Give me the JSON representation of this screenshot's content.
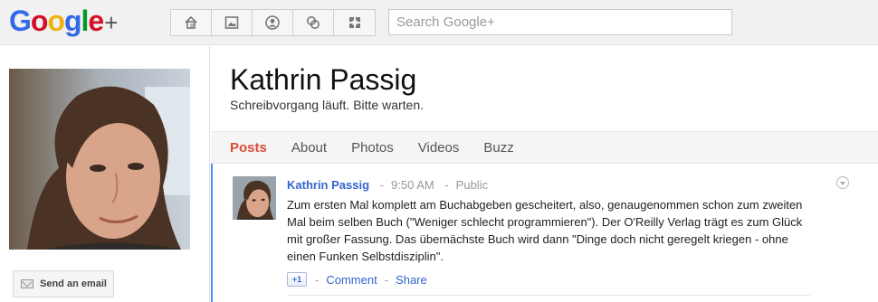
{
  "brand": {
    "logo_letters": [
      "G",
      "o",
      "o",
      "g",
      "l",
      "e"
    ],
    "logo_plus": "+",
    "colors": {
      "blue": "#3369e8",
      "red": "#d50f25",
      "yellow": "#eeb211",
      "green": "#009925",
      "link": "#3366cc",
      "active_tab": "#dd4b39",
      "stream_bar": "#4d90fe"
    }
  },
  "nav": {
    "icons": [
      "home-icon",
      "photos-icon",
      "profile-icon",
      "circles-icon",
      "games-icon"
    ]
  },
  "search": {
    "placeholder": "Search Google+"
  },
  "profile": {
    "name": "Kathrin Passig",
    "tagline": "Schreibvorgang läuft. Bitte warten.",
    "send_email_label": "Send an email"
  },
  "tabs": [
    {
      "label": "Posts",
      "active": true
    },
    {
      "label": "About",
      "active": false
    },
    {
      "label": "Photos",
      "active": false
    },
    {
      "label": "Videos",
      "active": false
    },
    {
      "label": "Buzz",
      "active": false
    }
  ],
  "post": {
    "author": "Kathrin Passig",
    "time": "9:50 AM",
    "visibility": "Public",
    "separator": "-",
    "body": "Zum ersten Mal komplett am Buchabgeben gescheitert, also, genaugenommen schon zum zweiten Mal beim selben Buch (\"Weniger schlecht programmieren\"). Der O'Reilly Verlag trägt es zum Glück mit großer Fassung. Das übernächste Buch wird dann \"Dinge doch nicht geregelt kriegen - ohne einen Funken Selbstdisziplin\".",
    "plus_one": "+1",
    "comment_label": "Comment",
    "share_label": "Share"
  }
}
